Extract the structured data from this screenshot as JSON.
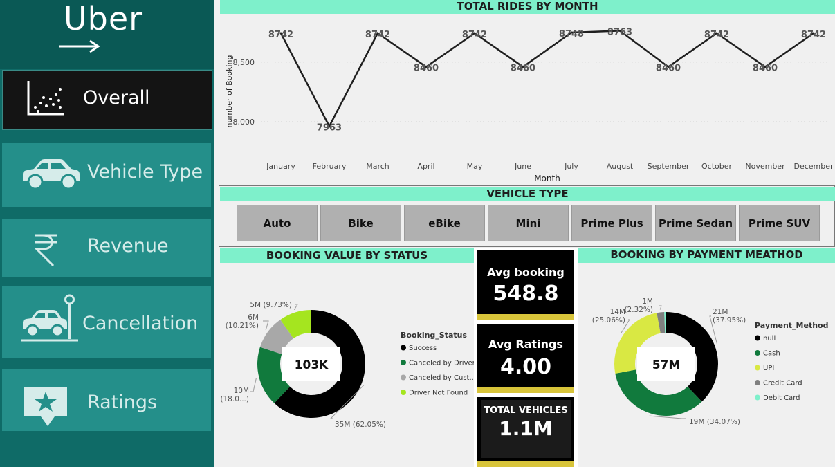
{
  "brand": {
    "name": "Uber"
  },
  "sidebar": {
    "items": [
      {
        "label": "Overall",
        "icon": "scatter-chart-icon",
        "active": true
      },
      {
        "label": "Vehicle Type",
        "icon": "car-icon",
        "active": false
      },
      {
        "label": "Revenue",
        "icon": "rupee-icon",
        "active": false
      },
      {
        "label": "Cancellation",
        "icon": "car-crash-icon",
        "active": false
      },
      {
        "label": "Ratings",
        "icon": "star-badge-icon",
        "active": false
      }
    ]
  },
  "line_panel": {
    "title": "TOTAL RIDES BY MONTH"
  },
  "vehicle_panel": {
    "title": "VEHICLE TYPE",
    "types": [
      "Auto",
      "Bike",
      "eBike",
      "Mini",
      "Prime Plus",
      "Prime Sedan",
      "Prime SUV"
    ]
  },
  "status_panel": {
    "title": "BOOKING VALUE BY STATUS",
    "center_label": "103K"
  },
  "payment_panel": {
    "title": "BOOKING BY PAYMENT MEATHOD",
    "center_label": "57M"
  },
  "kpis": {
    "avg_booking": {
      "label": "Avg booking",
      "value": "548.8"
    },
    "avg_ratings": {
      "label": "Avg Ratings",
      "value": "4.00"
    },
    "total_vehicles": {
      "label": "TOTAL VEHICLES",
      "value": "1.1M"
    }
  },
  "colors": {
    "accent": "#7ef0cb",
    "sidebar": "#0f6b67",
    "kpi_bar": "#d8c43a"
  },
  "chart_data": [
    {
      "type": "line",
      "title": "TOTAL RIDES BY MONTH",
      "xlabel": "Month",
      "ylabel": "number of Booking",
      "categories": [
        "January",
        "February",
        "March",
        "April",
        "May",
        "June",
        "July",
        "August",
        "September",
        "October",
        "November",
        "December"
      ],
      "series": [
        {
          "values": [
            8742,
            7963,
            8742,
            8460,
            8742,
            8460,
            8748,
            8763,
            8460,
            8742,
            8460,
            8742
          ]
        }
      ],
      "data_labels": [
        "8742",
        "7963",
        "8742",
        "8460",
        "8742",
        "8460",
        "8748",
        "8763",
        "8460",
        "8742",
        "8460",
        "8742"
      ],
      "yticks": [
        "8,000",
        "8,500"
      ],
      "ylim": [
        7850,
        8800
      ],
      "grid": true
    },
    {
      "type": "pie",
      "title": "BOOKING VALUE BY STATUS",
      "legend_title": "Booking_Status",
      "legend_position": "right",
      "center_label": "103K",
      "slices": [
        {
          "name": "Success",
          "value": 62.05,
          "label": "35M (62.05%)",
          "color": "#000000"
        },
        {
          "name": "Canceled by Driver",
          "value": 18.0,
          "label_lines": [
            "10M",
            "(18.0...)"
          ],
          "color": "#117a3d"
        },
        {
          "name": "Canceled by Cust...",
          "value": 10.21,
          "label_lines": [
            "6M",
            "(10.21%)"
          ],
          "color": "#a8a8a8"
        },
        {
          "name": "Driver Not Found",
          "value": 9.73,
          "label": "5M (9.73%)",
          "color": "#a5e51f"
        }
      ]
    },
    {
      "type": "pie",
      "title": "BOOKING BY PAYMENT MEATHOD",
      "legend_title": "Payment_Method",
      "legend_position": "right",
      "center_label": "57M",
      "slices": [
        {
          "name": "null",
          "value": 37.95,
          "label_lines": [
            "21M",
            "(37.95%)"
          ],
          "color": "#000000"
        },
        {
          "name": "Cash",
          "value": 34.07,
          "label": "19M (34.07%)",
          "color": "#117a3d"
        },
        {
          "name": "UPI",
          "value": 25.06,
          "label_lines": [
            "14M",
            "(25.06%)"
          ],
          "color": "#d9e843"
        },
        {
          "name": "Credit Card",
          "value": 2.32,
          "label_lines": [
            "1M",
            "(2.32%)"
          ],
          "color": "#808080"
        },
        {
          "name": "Debit Card",
          "value": 0.6,
          "label": "",
          "color": "#7ef0cb"
        }
      ]
    }
  ]
}
